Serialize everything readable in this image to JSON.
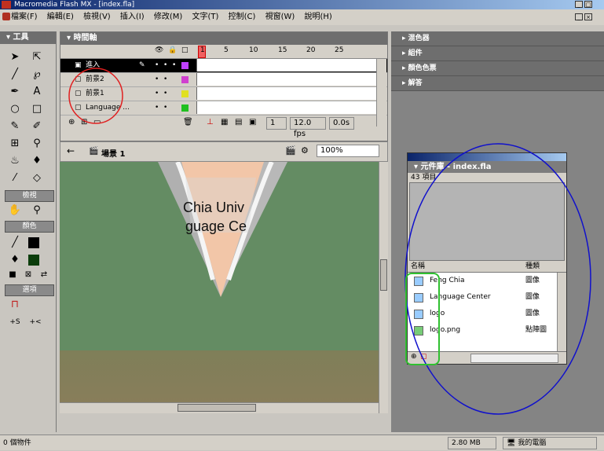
{
  "window": {
    "title": "Macromedia Flash MX - [index.fla]"
  },
  "menu": [
    "檔案(F)",
    "編輯(E)",
    "檢視(V)",
    "插入(I)",
    "修改(M)",
    "文字(T)",
    "控制(C)",
    "視窗(W)",
    "說明(H)"
  ],
  "toolbox": {
    "title": "工具",
    "view_label": "檢視",
    "color_label": "顏色",
    "options_label": "選項"
  },
  "timeline": {
    "title": "時間軸",
    "frame_numbers": [
      "1",
      "5",
      "10",
      "15",
      "20",
      "25"
    ],
    "layers": [
      {
        "name": "進入",
        "selected": true
      },
      {
        "name": "前景2",
        "selected": false
      },
      {
        "name": "前景1",
        "selected": false
      },
      {
        "name": "Language ...",
        "selected": false
      }
    ],
    "current_frame": "1",
    "fps": "12.0 fps",
    "time": "0.0s"
  },
  "stage_bar": {
    "scene": "場景 1",
    "zoom": "100%"
  },
  "stage": {
    "text_line1": "Chia Univ",
    "text_line2": "guage Ce"
  },
  "right_panels": [
    "混色器",
    "組件",
    "顏色色票",
    "解答"
  ],
  "library": {
    "title": "元件庫 - index.fla",
    "count": "43 項目",
    "col_name": "名稱",
    "col_kind": "種類",
    "items": [
      {
        "name": "Feng Chia",
        "kind": "圖像"
      },
      {
        "name": "Language Center",
        "kind": "圖像"
      },
      {
        "name": "logo",
        "kind": "圖像"
      },
      {
        "name": "logo.png",
        "kind": "點陣圖"
      }
    ]
  },
  "status": {
    "left": "0 個物件",
    "size": "2.80 MB",
    "computer": "我的電腦"
  },
  "colors": {
    "annotation_red": "#e02020",
    "annotation_blue": "#1010cc",
    "annotation_green": "#30c030"
  }
}
